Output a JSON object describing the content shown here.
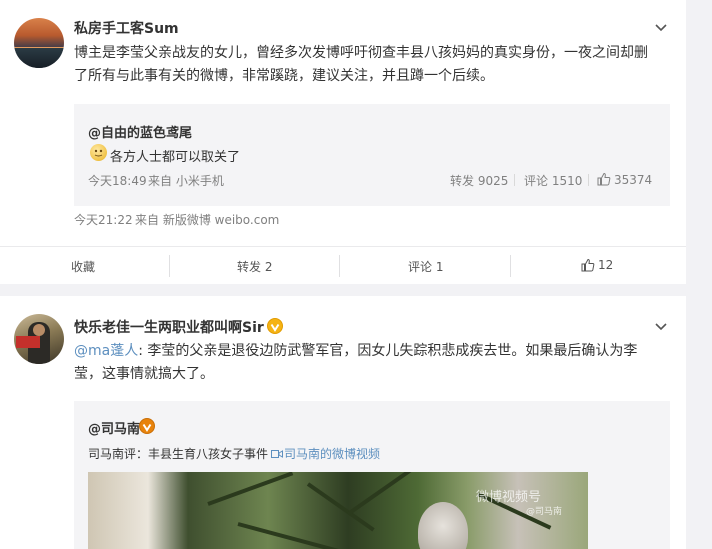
{
  "post1": {
    "username": "私房手工客Sum",
    "text_line1": "博主是李莹父亲战友的女儿，曾经多次发博呼吁彻查丰县八孩妈妈的真实身份，一夜之间却删",
    "text_line2": "了所有与此事有关的微博，非常蹊跷，建议关注，并且蹲一个后续。",
    "quote": {
      "author": "@自由的蓝色鸢尾",
      "text": "各方人士都可以取关了",
      "time": "今天18:49",
      "source": "来自 小米手机",
      "repost_label": "转发 9025",
      "comment_label": "评论 1510",
      "likes": "35374"
    },
    "time": "今天21:22",
    "source": "来自 新版微博 weibo.com",
    "actions": {
      "favorite": "收藏",
      "repost": "转发 2",
      "comment": "评论 1",
      "like": "12"
    }
  },
  "post2": {
    "username": "快乐老佳一生两职业都叫啊Sir",
    "mention": "@ma蓬人",
    "text_line1_rest": ": 李莹的父亲是退役边防武警军官，因女儿失踪积悲成疾去世。如果最后确认为李",
    "text_line2": "莹，这事情就搞大了。",
    "quote": {
      "author": "@司马南",
      "prefix": "司马南评：丰县生育八孩女子事件",
      "video_link": "司马南的微博视频",
      "watermark": "微博视频号",
      "watermark_sub": "@司马南"
    }
  },
  "icons": [
    "chevron-down-icon",
    "emoji-icon",
    "thumbs-up-icon",
    "verified-badge-icon",
    "video-link-icon"
  ],
  "colors": {
    "link": "#eb7350",
    "blue_link": "#5d8fbf",
    "verified": "#f5b314"
  }
}
